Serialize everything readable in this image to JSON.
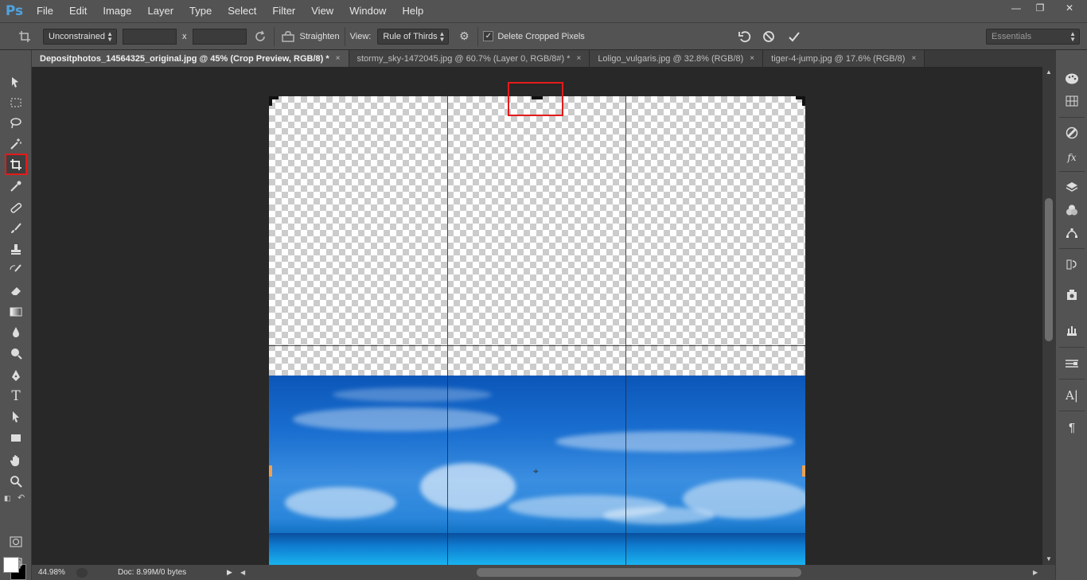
{
  "app": {
    "logo": "Ps"
  },
  "menu": [
    "File",
    "Edit",
    "Image",
    "Layer",
    "Type",
    "Select",
    "Filter",
    "View",
    "Window",
    "Help"
  ],
  "window_controls": {
    "minimize": "—",
    "restore": "❐",
    "close": "✕"
  },
  "options": {
    "ratio": "Unconstrained",
    "x_sep": "x",
    "straighten": "Straighten",
    "view_label": "View:",
    "view_value": "Rule of Thirds",
    "delete_cropped": "Delete Cropped Pixels",
    "delete_cropped_checked": true,
    "workspace": "Essentials"
  },
  "tabs": [
    {
      "label": "Depositphotos_14564325_original.jpg @ 45% (Crop Preview, RGB/8) *",
      "active": true
    },
    {
      "label": "stormy_sky-1472045.jpg @ 60.7% (Layer 0, RGB/8#) *",
      "active": false
    },
    {
      "label": "Loligo_vulgaris.jpg @ 32.8% (RGB/8)",
      "active": false
    },
    {
      "label": "tiger-4-jump.jpg @ 17.6% (RGB/8)",
      "active": false
    }
  ],
  "tab_close": "×",
  "status": {
    "zoom": "44.98%",
    "doc": "Doc: 8.99M/0 bytes"
  },
  "active_tool": "crop",
  "colors": {
    "foreground": "#ffffff",
    "background": "#000000",
    "highlight": "#e31b1b"
  }
}
